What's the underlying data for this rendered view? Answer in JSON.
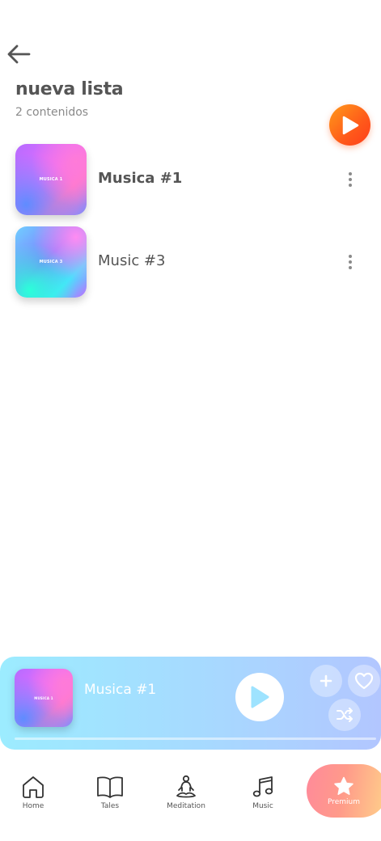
{
  "header": {
    "back_icon": "arrow-left-icon",
    "title": "nueva lista",
    "count": "2 contenidos",
    "play_all_icon": "play-icon",
    "accent": "#ff5a1a"
  },
  "tracks": [
    {
      "title": "Musica #1",
      "cover_label": "MUSICA 1",
      "menu_icon": "more-vertical-icon"
    },
    {
      "title": "Music #3",
      "cover_label": "MUSICA 3",
      "menu_icon": "more-vertical-icon"
    }
  ],
  "player": {
    "title": "Musica #1",
    "cover_label": "MUSICA 1",
    "play_icon": "play-icon",
    "add_icon": "plus-icon",
    "favorite_icon": "heart-icon",
    "shuffle_icon": "shuffle-icon",
    "progress": 0.0
  },
  "nav": {
    "home": "Home",
    "tales": "Tales",
    "meditation": "Meditation",
    "music": "Music",
    "premium": "Premium"
  }
}
